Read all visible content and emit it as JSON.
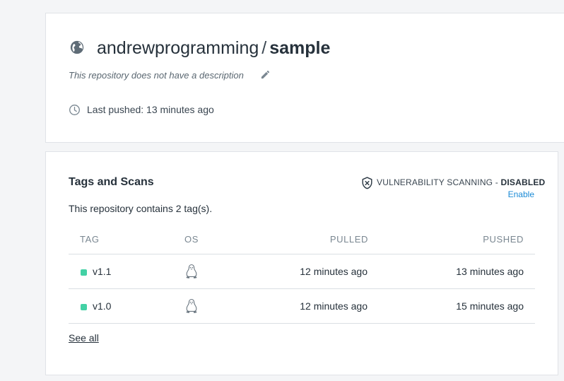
{
  "repo": {
    "owner": "andrewprogramming",
    "separator": "/",
    "name": "sample",
    "description": "This repository does not have a description",
    "last_pushed": "Last pushed: 13 minutes ago",
    "visibility_icon": "globe-icon",
    "edit_icon": "pencil-icon"
  },
  "tags_section": {
    "title": "Tags and Scans",
    "scan_label": "VULNERABILITY SCANNING - ",
    "scan_state": "DISABLED",
    "enable_link": "Enable",
    "count_text": "This repository contains 2 tag(s).",
    "columns": {
      "tag": "TAG",
      "os": "OS",
      "pulled": "PULLED",
      "pushed": "PUSHED"
    },
    "rows": [
      {
        "tag": "v1.1",
        "os_icon": "linux-icon",
        "pulled": "12 minutes ago",
        "pushed": "13 minutes ago"
      },
      {
        "tag": "v1.0",
        "os_icon": "linux-icon",
        "pulled": "12 minutes ago",
        "pushed": "15 minutes ago"
      }
    ],
    "see_all": "See all"
  },
  "colors": {
    "status_dot": "#43d1a5",
    "link": "#1a8ad6",
    "background": "#f4f5f7"
  }
}
